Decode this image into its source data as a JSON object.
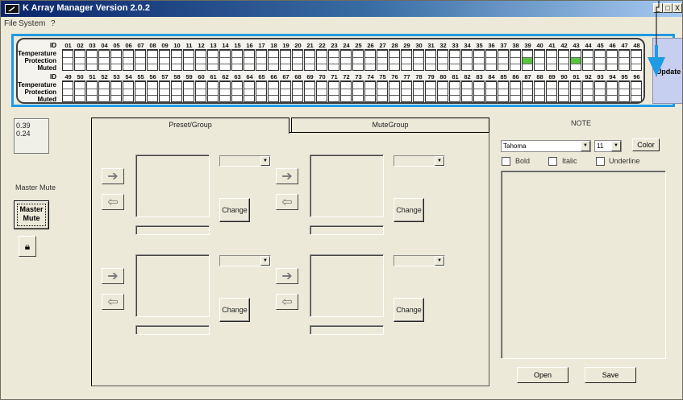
{
  "window": {
    "title": "K Array Manager Version 2.0.2",
    "controls": [
      "_",
      "□",
      "X"
    ]
  },
  "menu": {
    "items": [
      "File",
      "System",
      "?"
    ]
  },
  "status": {
    "labels": {
      "id": "ID",
      "temperature": "Temperature",
      "protection": "Protection",
      "muted": "Muted"
    },
    "ids_top": [
      "01",
      "02",
      "03",
      "04",
      "05",
      "06",
      "07",
      "08",
      "09",
      "10",
      "11",
      "12",
      "13",
      "14",
      "15",
      "16",
      "17",
      "18",
      "19",
      "20",
      "21",
      "22",
      "23",
      "24",
      "25",
      "26",
      "27",
      "28",
      "29",
      "30",
      "31",
      "32",
      "33",
      "34",
      "35",
      "36",
      "37",
      "38",
      "39",
      "40",
      "41",
      "42",
      "43",
      "44",
      "45",
      "46",
      "47",
      "48"
    ],
    "ids_bottom": [
      "49",
      "50",
      "51",
      "52",
      "53",
      "54",
      "55",
      "56",
      "57",
      "58",
      "59",
      "60",
      "61",
      "62",
      "63",
      "64",
      "65",
      "66",
      "67",
      "68",
      "69",
      "70",
      "71",
      "72",
      "73",
      "74",
      "75",
      "76",
      "77",
      "78",
      "79",
      "80",
      "81",
      "82",
      "83",
      "84",
      "85",
      "86",
      "87",
      "88",
      "89",
      "90",
      "91",
      "92",
      "93",
      "94",
      "95",
      "96"
    ],
    "active_protection_top": [
      "39",
      "43"
    ],
    "warning_color": "#58c43f",
    "update_label": "Update",
    "highlight_color": "#1f9be5"
  },
  "left": {
    "info_text": "0.39\n0.24",
    "master_mute_label": "Master Mute",
    "master_mute_button": "Master\nMute",
    "lock_icon": "lock-icon"
  },
  "tabs": [
    {
      "label": "Preset/Group"
    },
    {
      "label": "MuteGroup"
    }
  ],
  "groups": [
    {
      "change_label": "Change"
    },
    {
      "change_label": "Change"
    },
    {
      "change_label": "Change"
    },
    {
      "change_label": "Change"
    }
  ],
  "note": {
    "title": "NOTE",
    "font": "Tahoma",
    "size": "11",
    "color_label": "Color",
    "checks": [
      {
        "label": "Bold"
      },
      {
        "label": "Italic"
      },
      {
        "label": "Underline"
      }
    ],
    "open_label": "Open",
    "save_label": "Save"
  }
}
